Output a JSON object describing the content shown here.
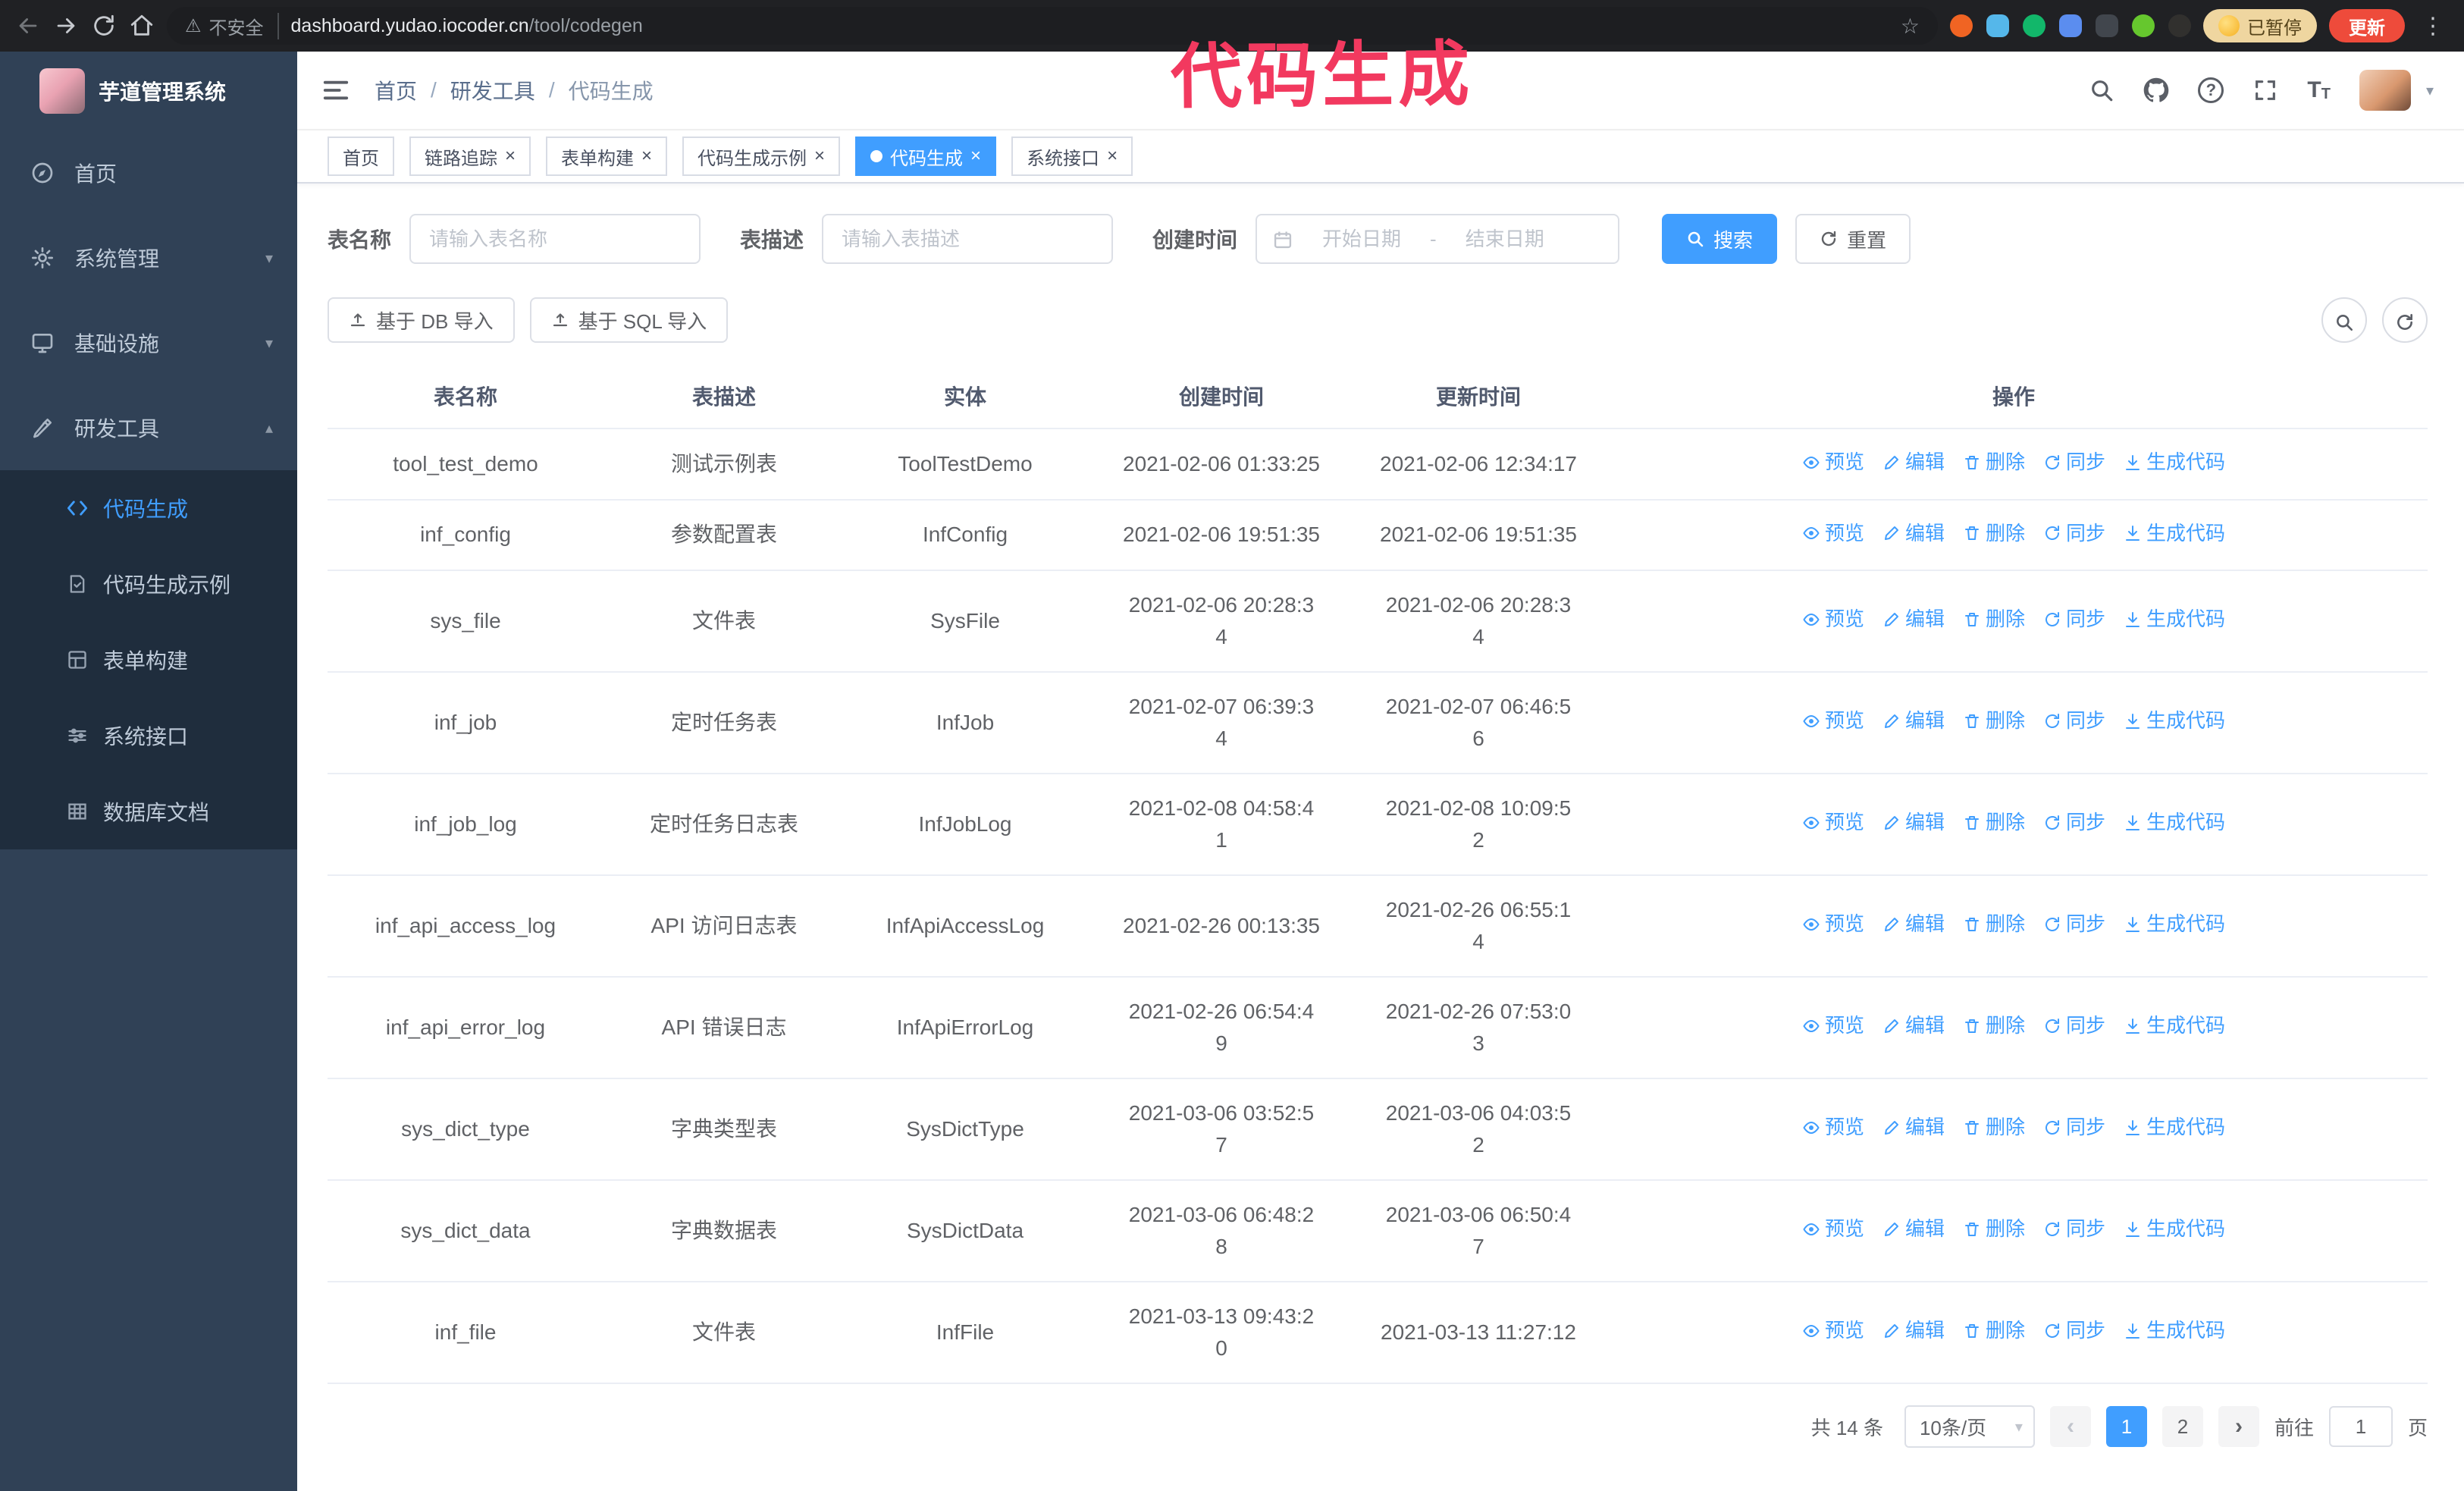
{
  "browser": {
    "security_label": "不安全",
    "url_domain": "dashboard.yudao.iocoder.cn",
    "url_path": "/tool/codegen",
    "paused_badge": "已暂停",
    "update_button": "更新"
  },
  "annotation": {
    "text": "代码生成",
    "color": "#f2395f"
  },
  "sidebar": {
    "logo_title": "芋道管理系统",
    "items": [
      {
        "label": "首页"
      },
      {
        "label": "系统管理"
      },
      {
        "label": "基础设施"
      },
      {
        "label": "研发工具"
      }
    ],
    "sub_items": [
      {
        "label": "代码生成",
        "active": true
      },
      {
        "label": "代码生成示例"
      },
      {
        "label": "表单构建"
      },
      {
        "label": "系统接口"
      },
      {
        "label": "数据库文档"
      }
    ]
  },
  "header": {
    "breadcrumb": [
      "首页",
      "研发工具",
      "代码生成"
    ]
  },
  "tabs": [
    {
      "label": "首页",
      "closable": false,
      "active": false
    },
    {
      "label": "链路追踪",
      "closable": true,
      "active": false
    },
    {
      "label": "表单构建",
      "closable": true,
      "active": false
    },
    {
      "label": "代码生成示例",
      "closable": true,
      "active": false
    },
    {
      "label": "代码生成",
      "closable": true,
      "active": true
    },
    {
      "label": "系统接口",
      "closable": true,
      "active": false
    }
  ],
  "filters": {
    "table_name_label": "表名称",
    "table_name_placeholder": "请输入表名称",
    "table_desc_label": "表描述",
    "table_desc_placeholder": "请输入表描述",
    "create_time_label": "创建时间",
    "date_start_placeholder": "开始日期",
    "date_separator": "-",
    "date_end_placeholder": "结束日期",
    "search_button": "搜索",
    "reset_button": "重置"
  },
  "toolbar": {
    "import_db": "基于 DB 导入",
    "import_sql": "基于 SQL 导入"
  },
  "table": {
    "columns": [
      "表名称",
      "表描述",
      "实体",
      "创建时间",
      "更新时间",
      "操作"
    ],
    "row_actions": [
      "预览",
      "编辑",
      "删除",
      "同步",
      "生成代码"
    ],
    "rows": [
      {
        "name": "tool_test_demo",
        "desc": "测试示例表",
        "entity": "ToolTestDemo",
        "created": "2021-02-06 01:33:25",
        "updated": "2021-02-06 12:34:17"
      },
      {
        "name": "inf_config",
        "desc": "参数配置表",
        "entity": "InfConfig",
        "created": "2021-02-06 19:51:35",
        "updated": "2021-02-06 19:51:35"
      },
      {
        "name": "sys_file",
        "desc": "文件表",
        "entity": "SysFile",
        "created": "2021-02-06 20:28:3\n4",
        "updated": "2021-02-06 20:28:3\n4"
      },
      {
        "name": "inf_job",
        "desc": "定时任务表",
        "entity": "InfJob",
        "created": "2021-02-07 06:39:3\n4",
        "updated": "2021-02-07 06:46:5\n6"
      },
      {
        "name": "inf_job_log",
        "desc": "定时任务日志表",
        "entity": "InfJobLog",
        "created": "2021-02-08 04:58:4\n1",
        "updated": "2021-02-08 10:09:5\n2"
      },
      {
        "name": "inf_api_access_log",
        "desc": "API 访问日志表",
        "entity": "InfApiAccessLog",
        "created": "2021-02-26 00:13:35",
        "updated": "2021-02-26 06:55:1\n4"
      },
      {
        "name": "inf_api_error_log",
        "desc": "API 错误日志",
        "entity": "InfApiErrorLog",
        "created": "2021-02-26 06:54:4\n9",
        "updated": "2021-02-26 07:53:0\n3"
      },
      {
        "name": "sys_dict_type",
        "desc": "字典类型表",
        "entity": "SysDictType",
        "created": "2021-03-06 03:52:5\n7",
        "updated": "2021-03-06 04:03:5\n2"
      },
      {
        "name": "sys_dict_data",
        "desc": "字典数据表",
        "entity": "SysDictData",
        "created": "2021-03-06 06:48:2\n8",
        "updated": "2021-03-06 06:50:4\n7"
      },
      {
        "name": "inf_file",
        "desc": "文件表",
        "entity": "InfFile",
        "created": "2021-03-13 09:43:2\n0",
        "updated": "2021-03-13 11:27:12"
      }
    ]
  },
  "pagination": {
    "total_text": "共 14 条",
    "page_size": "10条/页",
    "pages": [
      "1",
      "2"
    ],
    "current_page": "1",
    "prev_symbol": "‹",
    "next_symbol": "›",
    "goto_prefix": "前往",
    "goto_value": "1",
    "goto_suffix": "页"
  }
}
